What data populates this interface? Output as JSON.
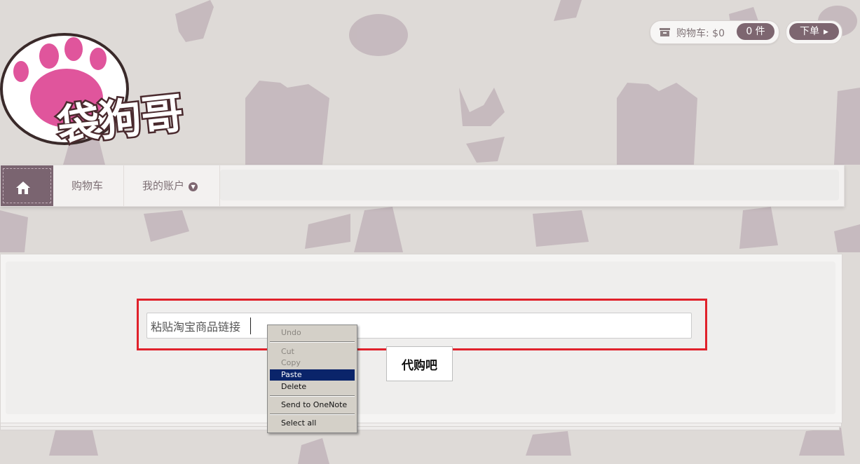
{
  "header": {
    "logo_text": "袋狗哥",
    "cart_label": "购物车: $0",
    "cart_count": "0 件",
    "checkout_label": "下单"
  },
  "icons": {
    "home": "home-icon",
    "cart": "cart-icon",
    "checkout_arrow": "arrow-right-icon",
    "account_dropdown": "chevron-down-icon"
  },
  "nav": {
    "items": [
      {
        "label": "购物车"
      },
      {
        "label": "我的账户"
      }
    ]
  },
  "main": {
    "input_value": "粘贴淘宝商品链接",
    "submit_label": "代购吧"
  },
  "context_menu": {
    "items": [
      {
        "label": "Undo",
        "state": "disabled"
      },
      {
        "label": "Cut",
        "state": "disabled"
      },
      {
        "label": "Copy",
        "state": "disabled"
      },
      {
        "label": "Paste",
        "state": "highlighted"
      },
      {
        "label": "Delete",
        "state": "enabled"
      },
      {
        "label": "Send to OneNote",
        "state": "enabled"
      },
      {
        "label": "Select all",
        "state": "enabled"
      }
    ]
  },
  "colors": {
    "brand_mauve": "#7d6670",
    "logo_pink": "#e0559c",
    "highlight_red": "#e0212b",
    "menu_highlight": "#0a246a"
  }
}
